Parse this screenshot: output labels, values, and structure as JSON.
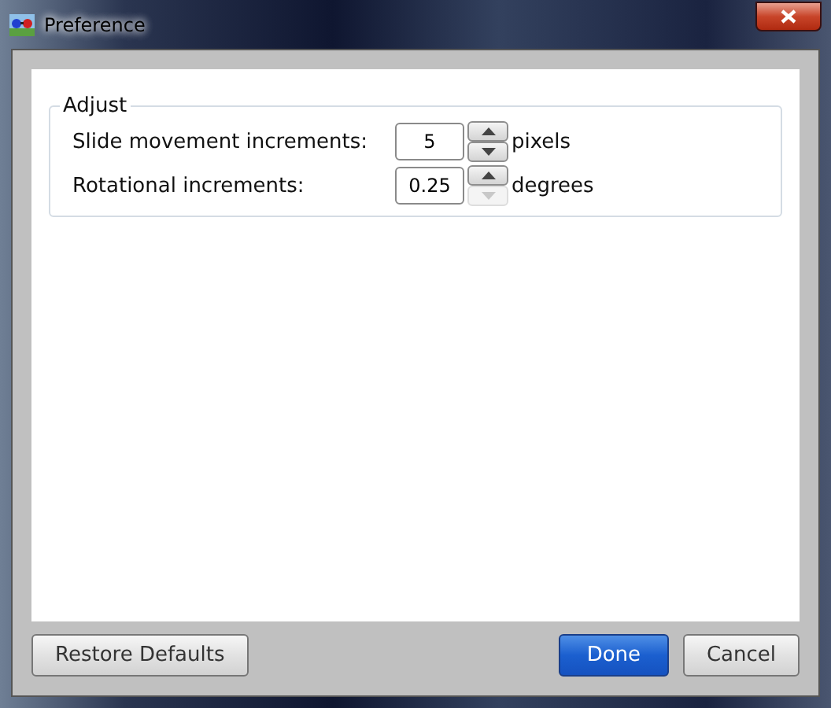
{
  "window": {
    "title": "Preference"
  },
  "group": {
    "title": "Adjust",
    "rows": [
      {
        "label": "Slide movement increments:",
        "value": "5",
        "unit": "pixels",
        "up_disabled": false,
        "down_disabled": false
      },
      {
        "label": "Rotational increments:",
        "value": "0.25",
        "unit": "degrees",
        "up_disabled": false,
        "down_disabled": true
      }
    ]
  },
  "left_buttons": [
    {
      "label": "Restore Defaults",
      "kind": "secondary"
    }
  ],
  "right_buttons": [
    {
      "label": "Done",
      "kind": "primary"
    },
    {
      "label": "Cancel",
      "kind": "secondary"
    }
  ]
}
